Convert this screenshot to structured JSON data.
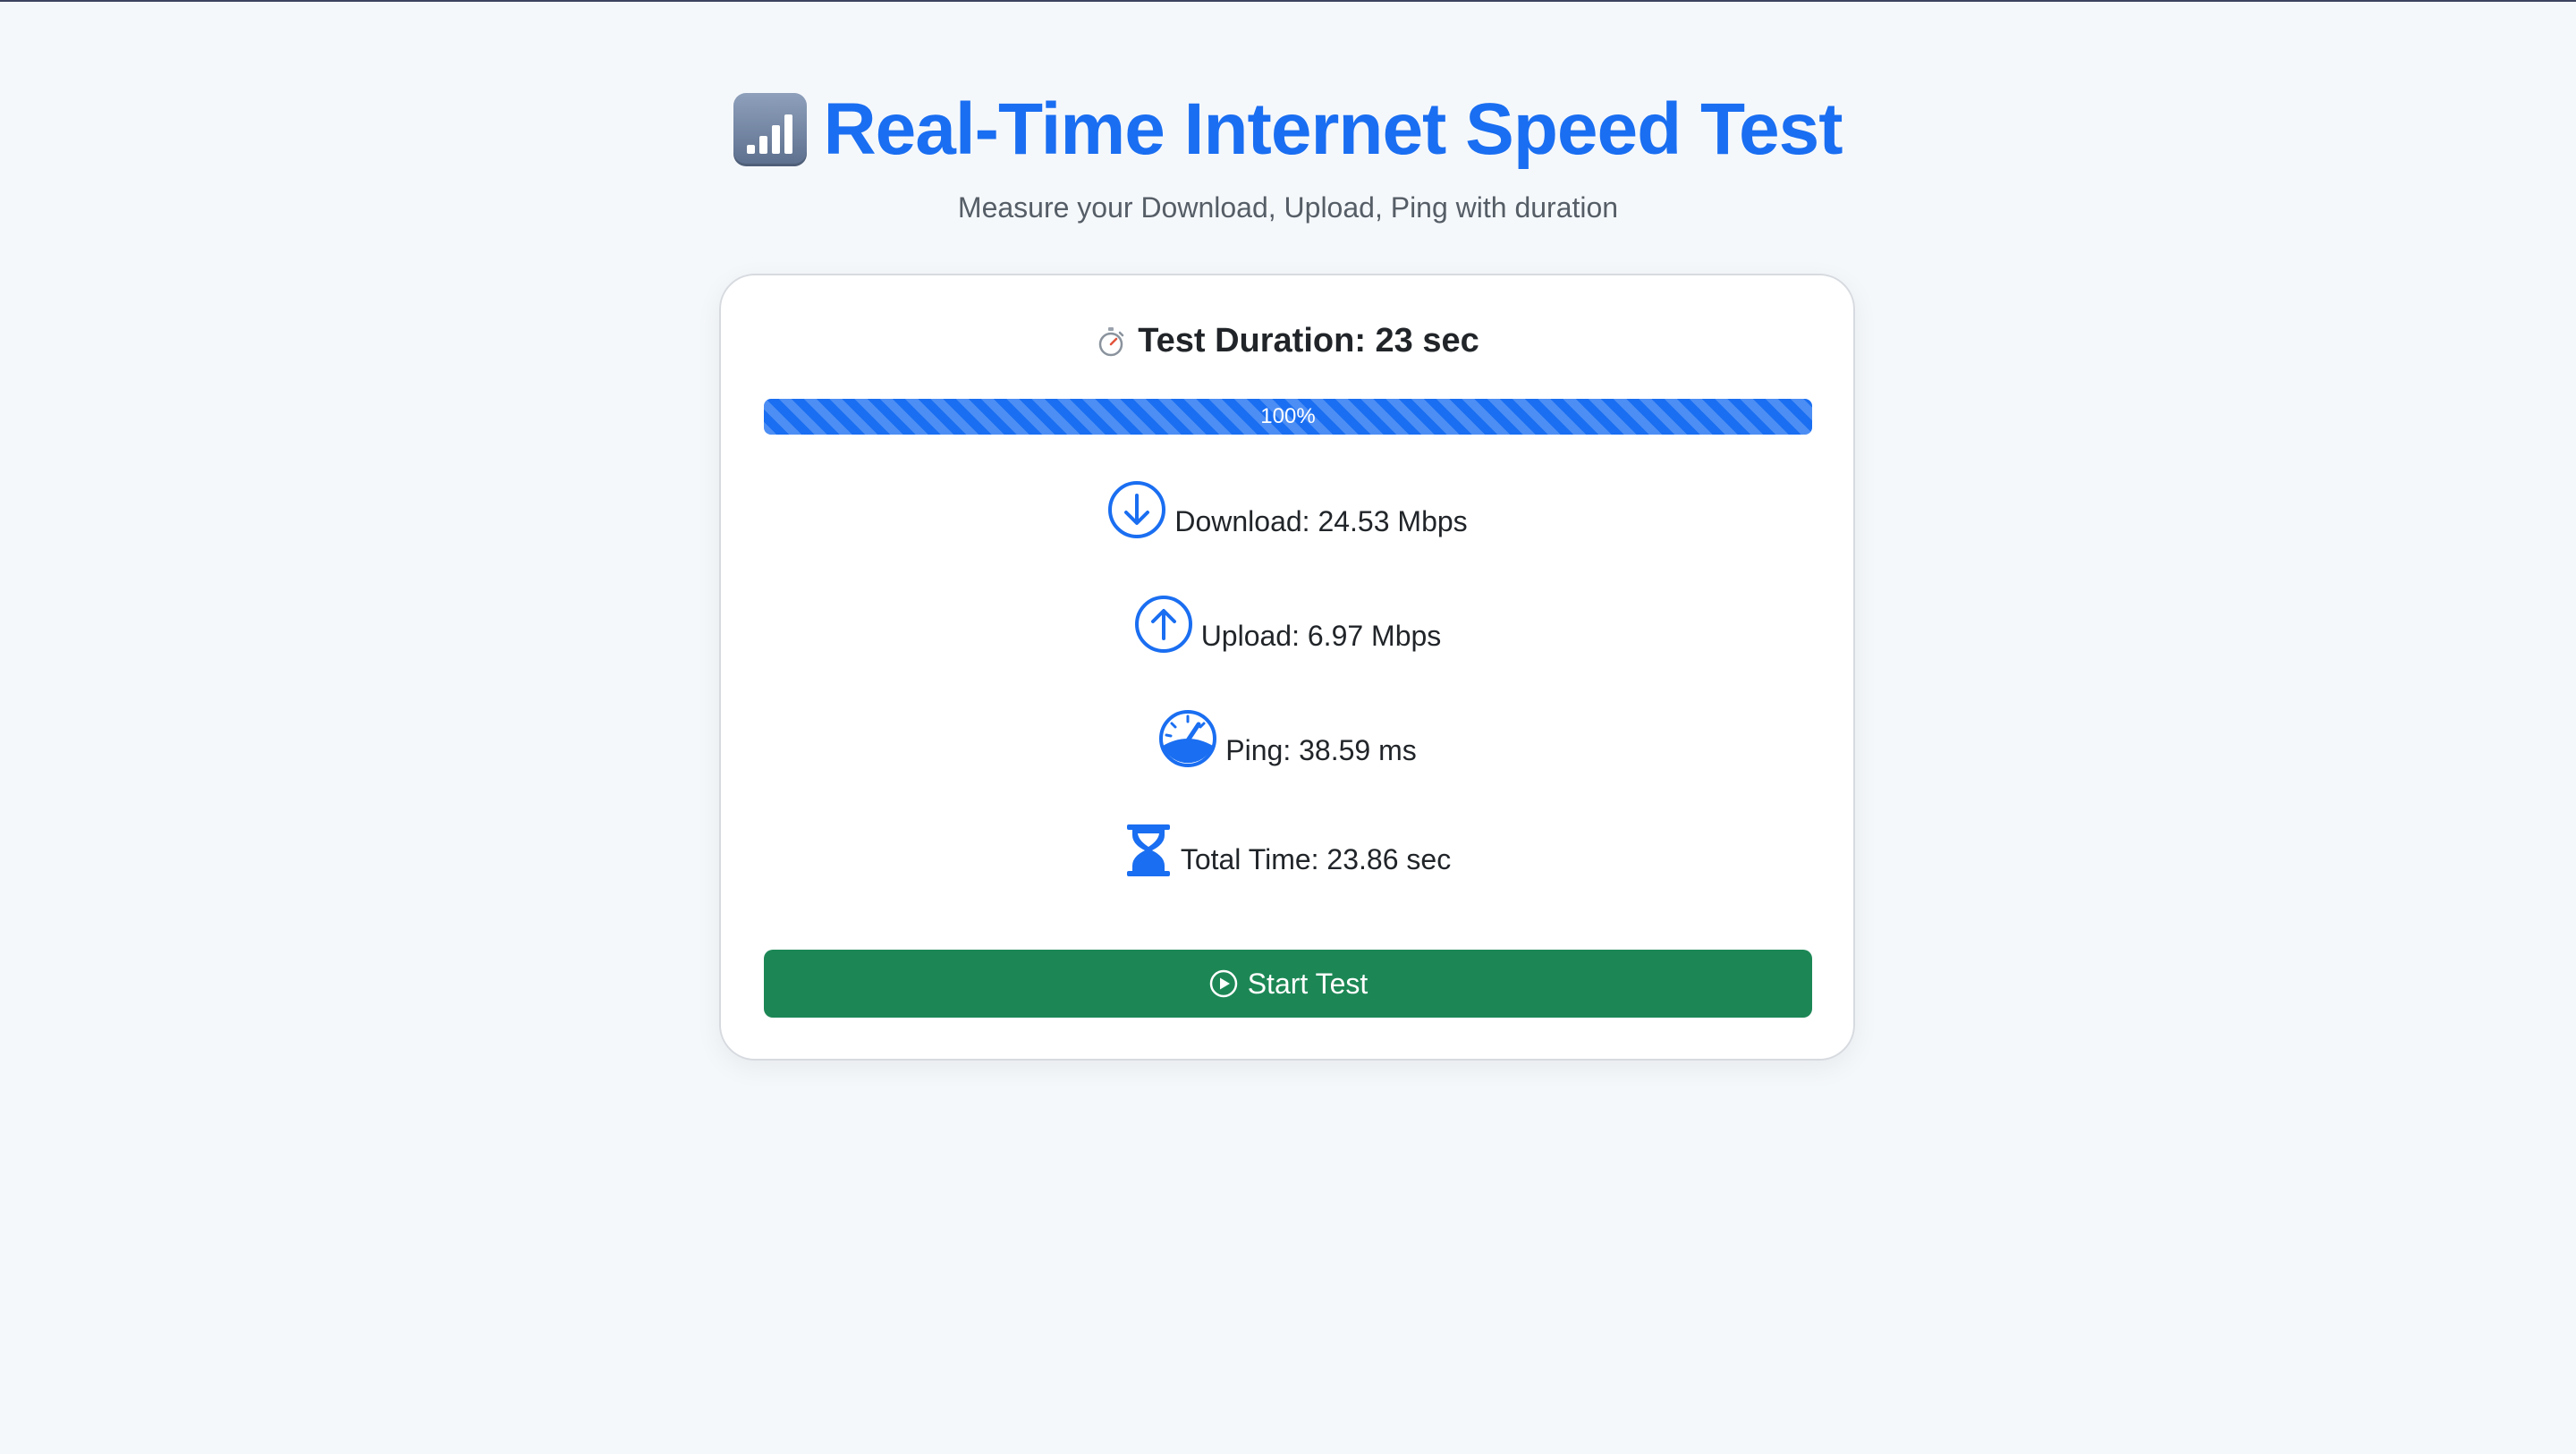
{
  "header": {
    "title": "Real-Time Internet Speed Test",
    "subtitle": "Measure your Download, Upload, Ping with duration",
    "title_icon": "signal-bars-icon"
  },
  "card": {
    "duration_label": "Test Duration: 23 sec",
    "duration_icon": "stopwatch-icon",
    "progress": {
      "percent": 100,
      "label": "100%"
    },
    "stats": [
      {
        "icon": "download-arrow-circle-icon",
        "label": "Download: 24.53 Mbps"
      },
      {
        "icon": "upload-arrow-circle-icon",
        "label": "Upload: 6.97 Mbps"
      },
      {
        "icon": "speedometer-icon",
        "label": "Ping: 38.59 ms"
      },
      {
        "icon": "hourglass-icon",
        "label": "Total Time: 23.86 sec"
      }
    ],
    "start_button": {
      "label": "Start Test",
      "icon": "play-circle-icon"
    }
  },
  "colors": {
    "accent": "#1a6ef1",
    "button": "#1c8755",
    "background": "#f5f8fb"
  }
}
